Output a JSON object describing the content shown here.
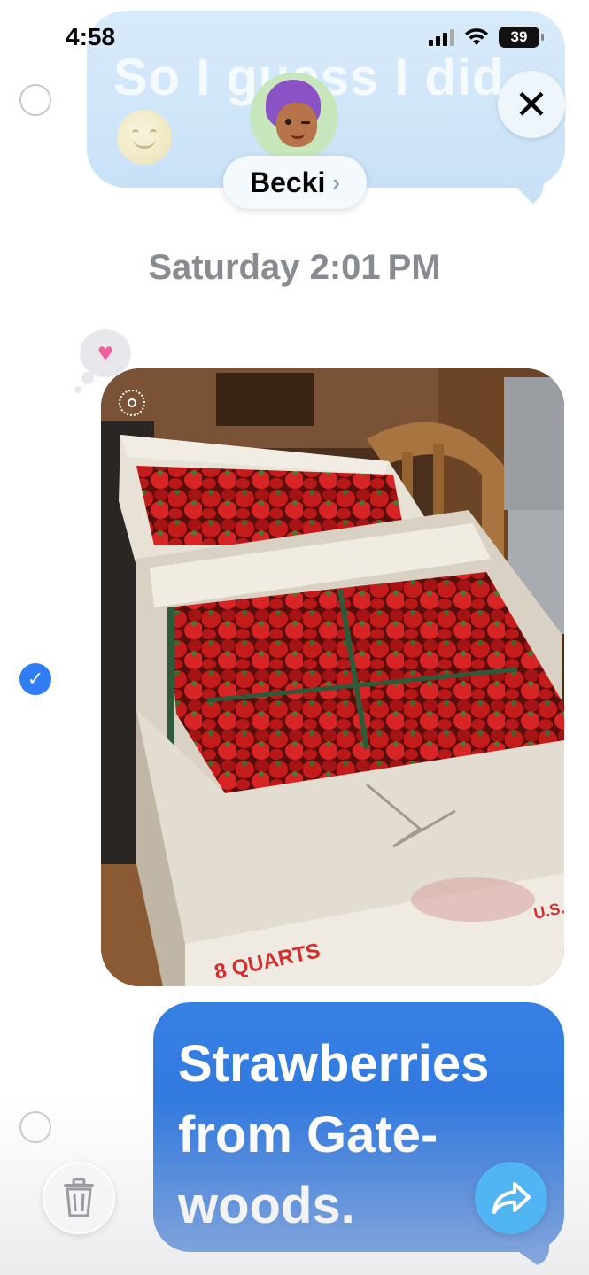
{
  "status_bar": {
    "time": "4:58",
    "battery": "39"
  },
  "header": {
    "previous_message": "So I guess I did",
    "contact_name": "Becki",
    "contact_chevron": "›",
    "close_label": "✕"
  },
  "thread": {
    "timestamp": "Saturday 2:01 PM",
    "photo_message": {
      "reaction": "heart",
      "box_label": "8 QUARTS",
      "box_label_secondary": "U.S."
    },
    "text_message": {
      "text": "Strawberries\nfrom Gate-\nwoods."
    }
  },
  "icons": {
    "close": "close-icon",
    "trash": "trash-icon",
    "forward": "forward-arrow-icon",
    "checkmark": "checkmark-icon",
    "live_photo": "live-photo-icon",
    "heart": "heart-icon"
  },
  "colors": {
    "blue_bubble": "#2f7cf5",
    "forward_button": "#52b5f3",
    "selected_check": "#2f7cf5",
    "faded_bubble": "#cfe5f8"
  }
}
